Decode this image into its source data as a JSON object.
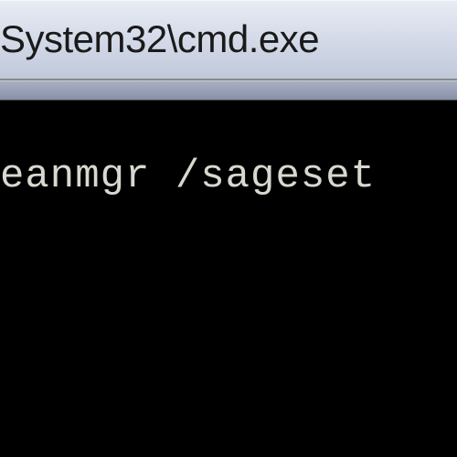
{
  "window": {
    "title": "System32\\cmd.exe"
  },
  "terminal": {
    "command_line": "eanmgr /sageset"
  }
}
